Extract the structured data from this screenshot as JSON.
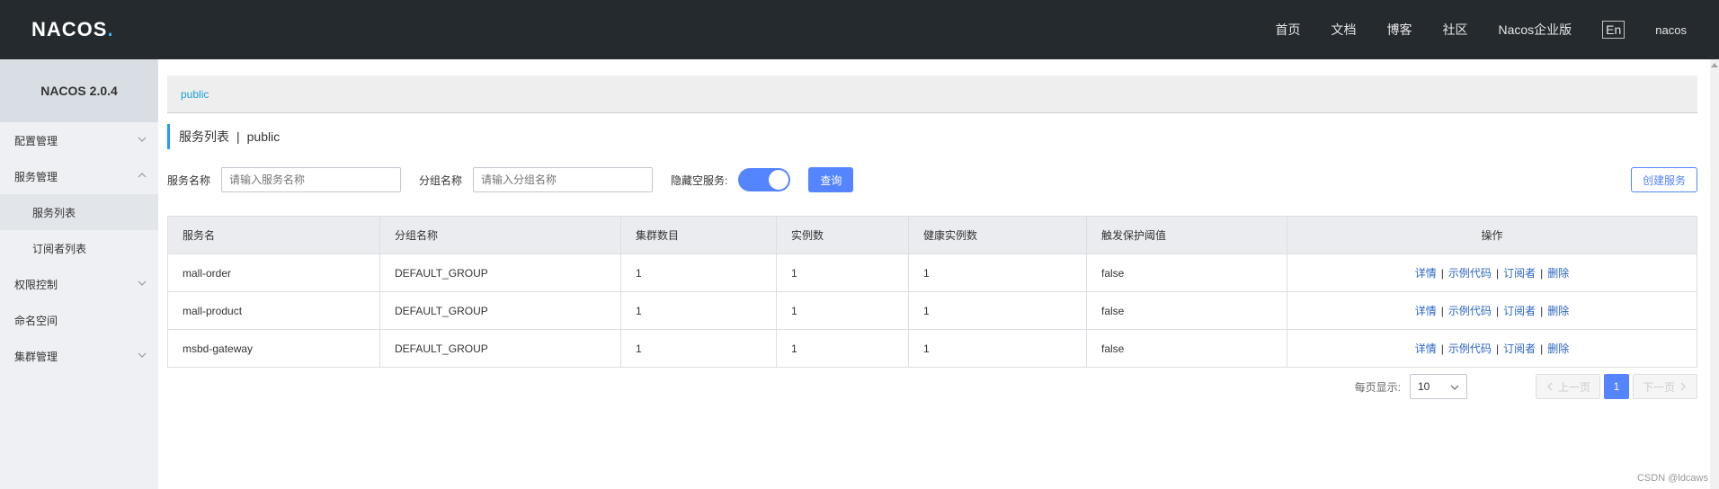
{
  "topbar": {
    "logo": "NACOS",
    "logo_dot": ".",
    "nav": [
      "首页",
      "文档",
      "博客",
      "社区",
      "Nacos企业版"
    ],
    "lang": "En",
    "user": "nacos"
  },
  "sidebar": {
    "version": "NACOS 2.0.4",
    "items": [
      {
        "label": "配置管理"
      },
      {
        "label": "服务管理"
      },
      {
        "label": "服务列表"
      },
      {
        "label": "订阅者列表"
      },
      {
        "label": "权限控制"
      },
      {
        "label": "命名空间"
      },
      {
        "label": "集群管理"
      }
    ]
  },
  "breadcrumb": "public",
  "title": {
    "main": "服务列表",
    "sep": "|",
    "ns": "public"
  },
  "filters": {
    "service_label": "服务名称",
    "service_placeholder": "请输入服务名称",
    "group_label": "分组名称",
    "group_placeholder": "请输入分组名称",
    "hide_empty_label": "隐藏空服务:",
    "query_label": "查询",
    "create_label": "创建服务"
  },
  "table": {
    "headers": [
      "服务名",
      "分组名称",
      "集群数目",
      "实例数",
      "健康实例数",
      "触发保护阈值",
      "操作"
    ],
    "rows": [
      [
        "mall-order",
        "DEFAULT_GROUP",
        "1",
        "1",
        "1",
        "false"
      ],
      [
        "mall-product",
        "DEFAULT_GROUP",
        "1",
        "1",
        "1",
        "false"
      ],
      [
        "msbd-gateway",
        "DEFAULT_GROUP",
        "1",
        "1",
        "1",
        "false"
      ]
    ],
    "ops": {
      "detail": "详情",
      "sample": "示例代码",
      "subscriber": "订阅者",
      "delete": "删除",
      "sep": "|"
    }
  },
  "pager": {
    "label": "每页显示:",
    "size": "10",
    "prev": "上一页",
    "current": "1",
    "next": "下一页"
  },
  "watermark": "CSDN @ldcaws"
}
